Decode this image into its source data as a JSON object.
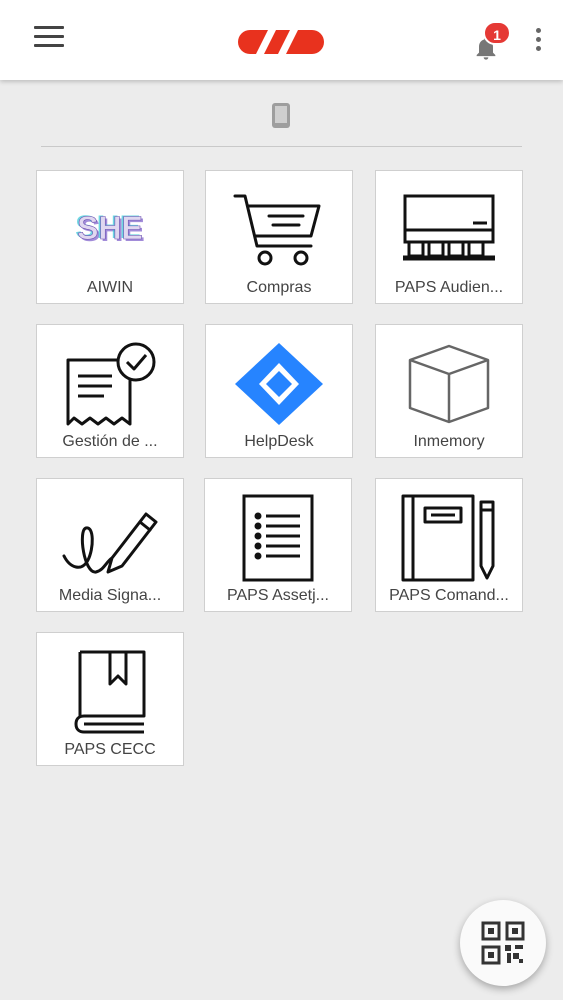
{
  "header": {
    "menu_icon": "hamburger-menu-icon",
    "logo": "brand-logo",
    "notification_icon": "bell-icon",
    "notification_count": "1",
    "more_icon": "more-vertical-icon"
  },
  "device_icon": "mobile-device-icon",
  "apps": [
    {
      "label": "AIWIN",
      "icon": "she-logo-icon",
      "logo_text": "SHE"
    },
    {
      "label": "Compras",
      "icon": "shopping-cart-icon"
    },
    {
      "label": "PAPS Audien...",
      "icon": "air-conditioner-icon"
    },
    {
      "label": "Gestión de ...",
      "icon": "receipt-check-icon"
    },
    {
      "label": "HelpDesk",
      "icon": "jira-icon"
    },
    {
      "label": "Inmemory",
      "icon": "cube-icon"
    },
    {
      "label": "Media Signa...",
      "icon": "signature-pen-icon"
    },
    {
      "label": "PAPS Assetj...",
      "icon": "document-list-icon"
    },
    {
      "label": "PAPS Comand...",
      "icon": "notebook-pencil-icon"
    },
    {
      "label": "PAPS CECC",
      "icon": "bookmark-book-icon"
    }
  ],
  "fab": {
    "icon": "qr-code-icon"
  },
  "colors": {
    "accent": "#e8321e",
    "badge": "#e53935",
    "jira": "#2684ff"
  }
}
